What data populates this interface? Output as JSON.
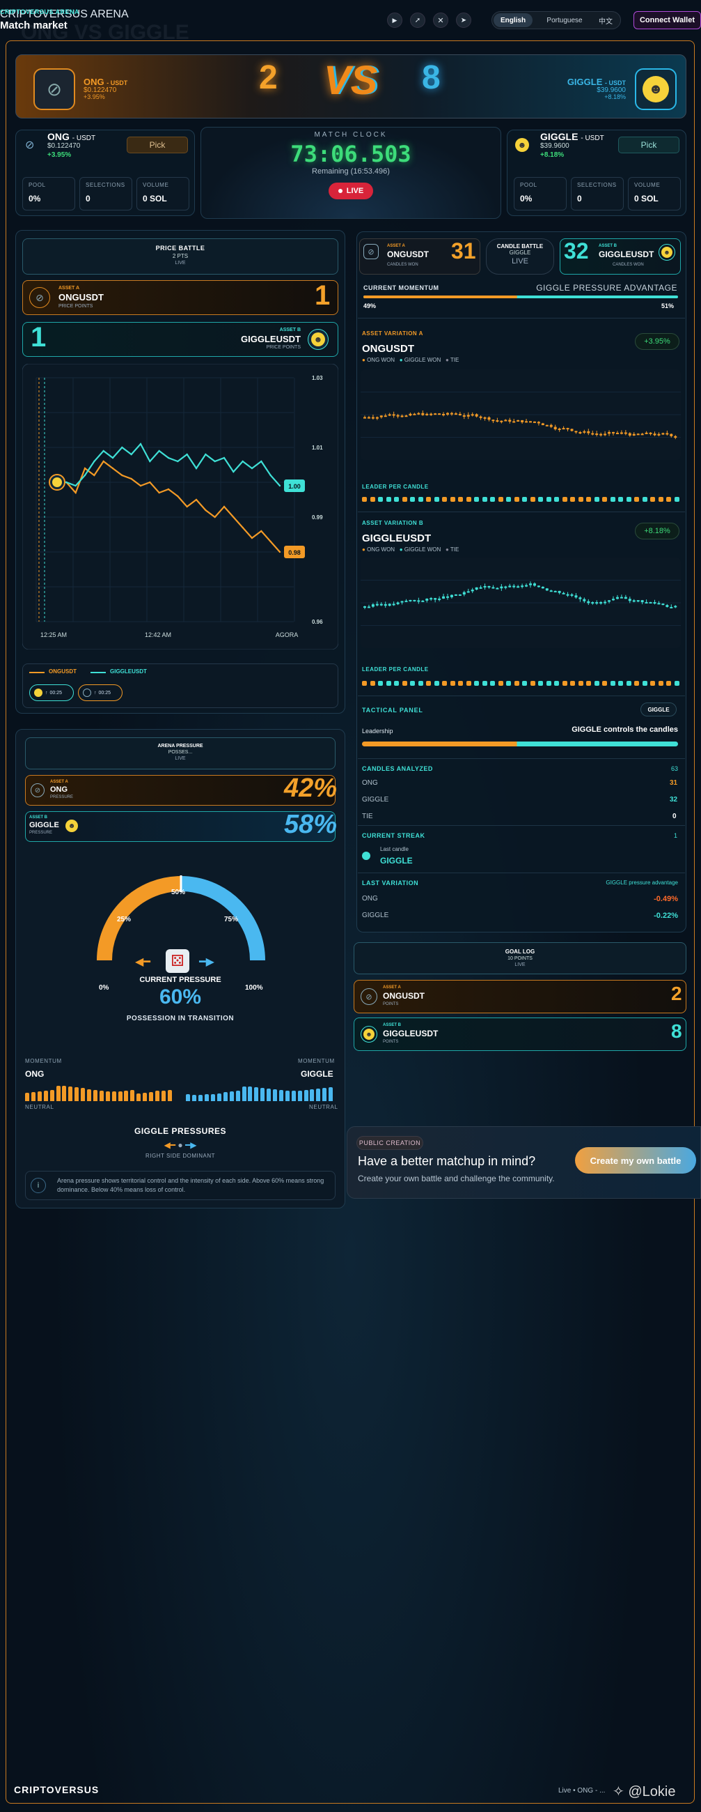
{
  "header": {
    "brand": "CRIPTOVERSUS ARENA",
    "title": "Match market",
    "lang_en": "English",
    "lang_pt": "Portuguese",
    "lang_zh": "中文",
    "connect": "Connect Wallet"
  },
  "versus": {
    "faded_title": "ONG VS GIGGLE",
    "a_name": "ONG",
    "a_quote": "- USDT",
    "a_price": "$0.122470",
    "a_change": "+3.95%",
    "a_score": "2",
    "vs": "VS",
    "b_score": "8",
    "b_name": "GIGGLE",
    "b_quote": "- USDT",
    "b_price": "$39.9600",
    "b_change": "+8.18%"
  },
  "side_a": {
    "name": "ONG",
    "quote": "- USDT",
    "price": "$0.122470",
    "change": "+3.95%",
    "pick": "Pick",
    "pool_label": "POOL",
    "pool": "0%",
    "sel_label": "SELECTIONS",
    "sel": "0",
    "vol_label": "VOLUME",
    "vol": "0 SOL"
  },
  "side_b": {
    "name": "GIGGLE",
    "quote": "- USDT",
    "price": "$39.9600",
    "change": "+8.18%",
    "pick": "Pick",
    "pool_label": "POOL",
    "pool": "0%",
    "sel_label": "SELECTIONS",
    "sel": "0",
    "vol_label": "VOLUME",
    "vol": "0 SOL"
  },
  "clock": {
    "label": "MATCH CLOCK",
    "time": "73:06.503",
    "remaining": "Remaining (16:53.496)",
    "live": "LIVE"
  },
  "price_battle": {
    "title": "PRICE BATTLE",
    "pts": "2 PTS",
    "live": "LIVE",
    "a_tag": "ASSET A",
    "a_sym": "ONGUSDT",
    "a_sub": "PRICE POINTS",
    "a_score": "1",
    "b_tag": "ASSET B",
    "b_sym": "GIGGLEUSDT",
    "b_sub": "PRICE POINTS",
    "b_score": "1"
  },
  "chart_data": {
    "type": "line",
    "x_ticks": [
      "12:25 AM",
      "12:42 AM",
      "AGORA"
    ],
    "y_ticks": [
      "1.03",
      "1.01",
      "0.99",
      "0.96"
    ],
    "ylim": [
      0.96,
      1.03
    ],
    "series": [
      {
        "name": "ONGUSDT",
        "color": "#f39a26",
        "end_label": "0.98",
        "values": [
          1.0,
          1.0,
          0.997,
          1.004,
          1.002,
          1.006,
          1.004,
          1.002,
          1.001,
          0.999,
          1.0,
          0.997,
          0.998,
          0.996,
          0.993,
          0.995,
          0.992,
          0.99,
          0.993,
          0.99,
          0.987,
          0.984,
          0.986,
          0.983,
          0.98
        ]
      },
      {
        "name": "GIGGLEUSDT",
        "color": "#3fe0d6",
        "end_label": "1.00",
        "values": [
          1.0,
          1.0,
          0.999,
          1.002,
          1.006,
          1.009,
          1.007,
          1.01,
          1.008,
          1.011,
          1.006,
          1.009,
          1.007,
          1.006,
          1.008,
          1.004,
          1.008,
          1.006,
          1.007,
          1.003,
          1.006,
          1.004,
          1.006,
          1.002,
          0.999
        ]
      }
    ]
  },
  "legend": {
    "a": "ONGUSDT",
    "b": "GIGGLEUSDT",
    "chip_a": "00:25",
    "chip_b": "00:25"
  },
  "candle_battle": {
    "a_tag": "ASSET A",
    "a_sym": "ONGUSDT",
    "a_sub": "CANDLES WON",
    "a_score": "31",
    "mid_title": "CANDLE BATTLE",
    "mid_sub": "GIGGLE",
    "mid_live": "LIVE",
    "b_tag": "ASSET B",
    "b_sym": "GIGGLEUSDT",
    "b_sub": "CANDLES WON",
    "b_score": "32"
  },
  "momentum": {
    "label": "CURRENT MOMENTUM",
    "adv": "GIGGLE PRESSURE ADVANTAGE",
    "a_pct": "49%",
    "b_pct": "51%",
    "a_frac": 0.49
  },
  "var_a": {
    "tag": "ASSET VARIATION A",
    "sym": "ONGUSDT",
    "change": "+3.95%",
    "l1": "ONG WON",
    "l2": "GIGGLE WON",
    "l3": "TIE",
    "leader": "LEADER PER CANDLE"
  },
  "var_b": {
    "tag": "ASSET VARIATION B",
    "sym": "GIGGLEUSDT",
    "change": "+8.18%",
    "l1": "ONG WON",
    "l2": "GIGGLE WON",
    "l3": "TIE",
    "leader": "LEADER PER CANDLE"
  },
  "tactical": {
    "title": "TACTICAL PANEL",
    "badge": "GIGGLE",
    "leader_label": "Leadership",
    "leader_text": "GIGGLE controls the candles",
    "analyzed_label": "CANDLES ANALYZED",
    "analyzed": "63",
    "ong_label": "ONG",
    "ong": "31",
    "giggle_label": "GIGGLE",
    "giggle": "32",
    "tie_label": "TIE",
    "tie": "0",
    "streak_label": "CURRENT STREAK",
    "streak": "1",
    "last_candle": "Last candle",
    "last_winner": "GIGGLE",
    "lv_label": "LAST VARIATION",
    "lv_adv": "GIGGLE pressure advantage",
    "lv_ong_label": "ONG",
    "lv_ong": "-0.49%",
    "lv_giggle_label": "GIGGLE",
    "lv_giggle": "-0.22%"
  },
  "goal_log": {
    "title": "GOAL LOG",
    "pts": "10 POINTS",
    "live": "LIVE",
    "a_tag": "ASSET A",
    "a_sym": "ONGUSDT",
    "a_sub": "POINTS",
    "a_score": "2",
    "b_tag": "ASSET B",
    "b_sym": "GIGGLEUSDT",
    "b_sub": "POINTS",
    "b_score": "8"
  },
  "pressure": {
    "title": "ARENA PRESSURE",
    "sub": "POSSES...",
    "live": "LIVE",
    "a_tag": "ASSET A",
    "a_name": "ONG",
    "a_sub": "PRESSURE",
    "a_pct": "42%",
    "b_tag": "ASSET B",
    "b_name": "GIGGLE",
    "b_sub": "PRESSURE",
    "b_pct": "58%",
    "g0": "0%",
    "g25": "25%",
    "g50": "50%",
    "g75": "75%",
    "g100": "100%",
    "current": "CURRENT PRESSURE",
    "current_val": "60%",
    "transition": "POSSESSION IN TRANSITION",
    "mom_l": "MOMENTUM",
    "mom_r": "MOMENTUM",
    "ong": "ONG",
    "giggle": "GIGGLE",
    "neutral_l": "NEUTRAL",
    "neutral_r": "NEUTRAL",
    "gp_title": "GIGGLE PRESSURES",
    "gp_sub": "RIGHT SIDE DOMINANT",
    "info": "Arena pressure shows territorial control and the intensity of each side. Above 60% means strong dominance. Below 40% means loss of control."
  },
  "promo": {
    "tag": "PUBLIC CREATION",
    "title": "Have a better matchup in mind?",
    "sub": "Create your own battle and challenge the community.",
    "cta": "Create my own battle"
  },
  "footer": {
    "brand": "CRIPTOVERSUS",
    "status": "Live • ONG - ...",
    "watermark": "@Lokie"
  }
}
